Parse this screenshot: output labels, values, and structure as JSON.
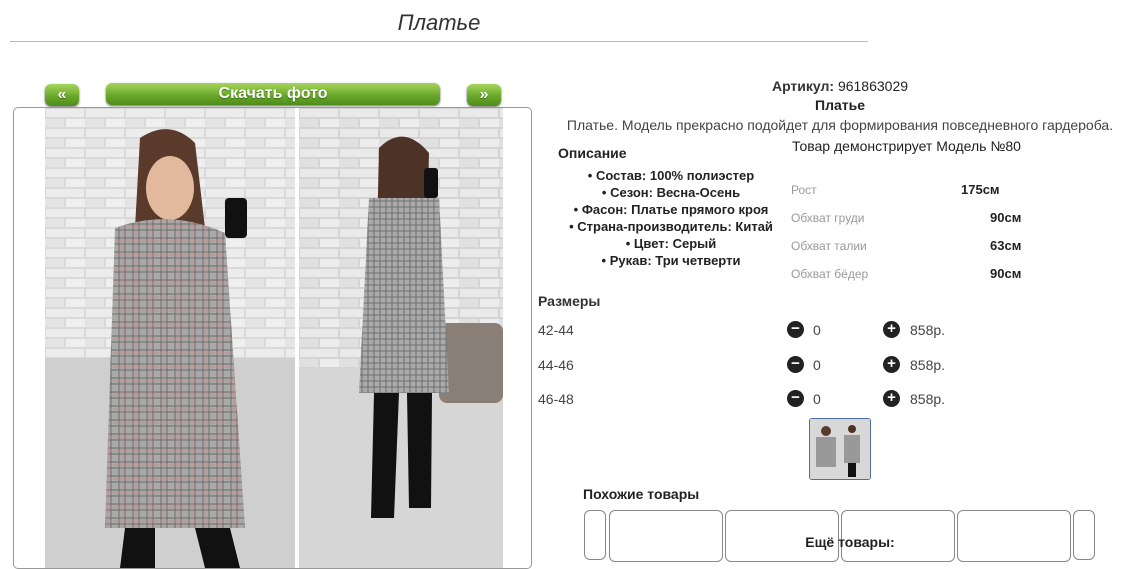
{
  "page": {
    "title": "Платье"
  },
  "gallery": {
    "prev_label": "«",
    "next_label": "»",
    "download_label": "Скачать фото"
  },
  "product": {
    "artikul_label": "Артикул:",
    "artikul_value": "961863029",
    "name": "Платье",
    "description": "Платье. Модель прекрасно подойдет для формирования повседневного гардероба."
  },
  "description": {
    "heading": "Описание",
    "items": [
      "Состав: 100% полиэстер",
      "Сезон: Весна-Осень",
      "Фасон: Платье прямого кроя",
      "Страна-производитель: Китай",
      "Цвет: Серый",
      "Рукав: Три четверти"
    ]
  },
  "model": {
    "heading": "Товар демонстрирует Модель №80",
    "params": [
      {
        "label": "Рост",
        "value": "175см"
      },
      {
        "label": "Обхват груди",
        "value": "90см"
      },
      {
        "label": "Обхват талии",
        "value": "63см"
      },
      {
        "label": "Обхват бёдер",
        "value": "90см"
      }
    ]
  },
  "sizes": {
    "heading": "Размеры",
    "rows": [
      {
        "size": "42-44",
        "qty": "0",
        "price": "858р."
      },
      {
        "size": "44-46",
        "qty": "0",
        "price": "858р."
      },
      {
        "size": "46-48",
        "qty": "0",
        "price": "858р."
      }
    ],
    "minus_icon": "minus-circle-icon",
    "plus_icon": "plus-circle-icon"
  },
  "similar": {
    "heading": "Похожие товары",
    "more_label": "Ещё товары:"
  },
  "colors": {
    "button_green": "#6aa82b",
    "thumb_border": "#4a6fa5"
  }
}
